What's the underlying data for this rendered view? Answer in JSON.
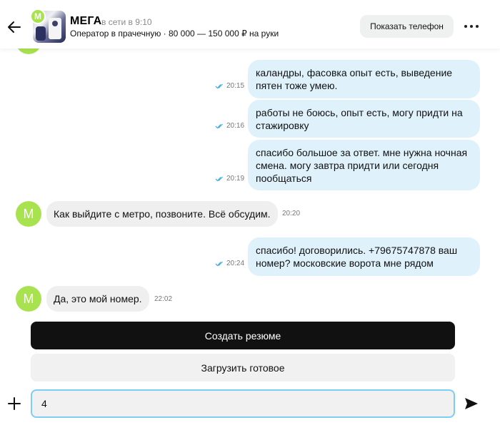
{
  "header": {
    "name": "МЕГА",
    "status": "в сети в 9:10",
    "vacancy": "Оператор в прачечную · 80 000 — 150 000 ₽ на руки",
    "avatar_letter": "М",
    "phone_button": "Показать телефон",
    "icons": {
      "back": "arrow-left-icon",
      "more": "more-dots-icon"
    }
  },
  "messages": [
    {
      "from": "me",
      "text": "каландры, фасовка опыт есть, выведение пятен тоже умею.",
      "time": "20:15",
      "read": true
    },
    {
      "from": "me",
      "text": "работы не боюсь, опыт есть, могу придти на стажировку",
      "time": "20:16",
      "read": true
    },
    {
      "from": "me",
      "text": "спасибо большое за ответ. мне нужна ночная смена.  могу завтра придти или сегодня пообщаться",
      "time": "20:19",
      "read": true
    },
    {
      "from": "them",
      "avatar": "М",
      "text": "Как выйдите с метро, позвоните. Всё обсудим.",
      "time": "20:20"
    },
    {
      "from": "me",
      "text": "спасибо! договорились. +79675747878 ваш номер? московские ворота мне рядом",
      "time": "20:24",
      "read": true
    },
    {
      "from": "them",
      "avatar": "М",
      "text": "Да, это мой номер.",
      "time": "22:02"
    }
  ],
  "actions": {
    "create_resume": "Создать резюме",
    "upload_ready": "Загрузить готовое"
  },
  "composer": {
    "value": "4",
    "icons": {
      "attach": "plus-icon",
      "send": "send-icon"
    }
  },
  "colors": {
    "accent_avatar": "#a8e24f",
    "outgoing_bubble": "#dff2fc",
    "incoming_bubble": "#efefef",
    "input_focus": "#7ccef3",
    "read_ticks": "#3da9e0"
  }
}
